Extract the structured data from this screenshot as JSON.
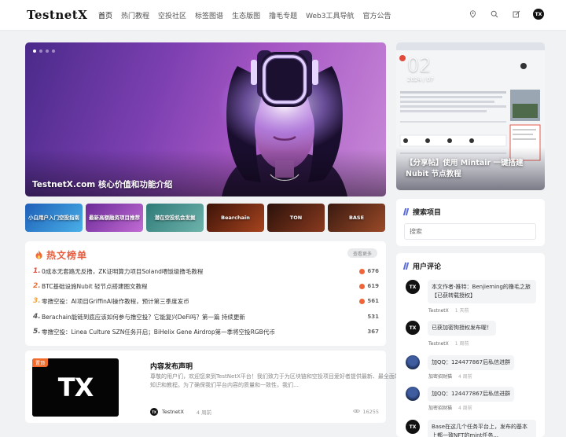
{
  "header": {
    "logo": "TestnetX",
    "nav": [
      "首页",
      "热门教程",
      "空投社区",
      "标签图谱",
      "生态版图",
      "撸毛专题",
      "Web3工具导航",
      "官方公告"
    ],
    "avatar_text": "TX"
  },
  "hero": {
    "caption": "TestnetX.com 核心价值和功能介绍"
  },
  "side_hero": {
    "day": "02",
    "month": "2024 / 07",
    "title": "【分享帖】使用 Mintair 一键搭建 Nubit 节点教程"
  },
  "thumbs": [
    {
      "label": "小白用户入门空投指南",
      "bg": "#2f7fd0"
    },
    {
      "label": "最新高额融资项目推荐",
      "bg": "#8a3aa8"
    },
    {
      "label": "潜在空投机会发掘",
      "bg": "#3d8b86"
    },
    {
      "label": "Bearchain",
      "bg": "#7b2a17"
    },
    {
      "label": "TON",
      "bg": "#3a1c12"
    },
    {
      "label": "BASE",
      "bg": "#4a2618"
    }
  ],
  "hot": {
    "title": "热文榜单",
    "more": "查看更多",
    "items": [
      {
        "rank": "1.",
        "title": "0成本无套路无反撸，ZK证明算力项目Soland喂饭级撸毛教程",
        "views": "676",
        "hot": true,
        "color": "#e74c3c"
      },
      {
        "rank": "2.",
        "title": "BTC基础设施Nubit 轻节点搭建图文教程",
        "views": "619",
        "hot": true,
        "color": "#e8743c"
      },
      {
        "rank": "3.",
        "title": "零撸空投：AI项目GriffinAI操作教程，预计第三季度发币",
        "views": "561",
        "hot": true,
        "color": "#f0a23c"
      },
      {
        "rank": "4.",
        "title": "Berachain能链到底应该如何参与撸空投？它能复兴DeFi吗？第一篇 持续更新",
        "views": "531",
        "hot": false,
        "color": "#555555"
      },
      {
        "rank": "5.",
        "title": "零撸空投：Linea Culture SZN任务开启；BiHelix Gene Airdrop第一季将空投RGB代币",
        "views": "367",
        "hot": false,
        "color": "#555555"
      }
    ]
  },
  "post": {
    "tag": "置顶",
    "thumb_text": "TX",
    "title": "内容发布声明",
    "excerpt": "尊敬的用户们，欢迎您来到TestNetX平台！我们致力于为区块链和空投项目爱好者提供最新、最全面的知识和教程。为了确保我们平台内容的质量和一致性，我们…",
    "author_avatar": "TX",
    "author": "TestnetX",
    "time": "4 周前",
    "views": "16255"
  },
  "search": {
    "title": "搜索项目",
    "placeholder": "搜索"
  },
  "comments": {
    "title": "用户评论",
    "items": [
      {
        "avatar": "TX",
        "pic": false,
        "text": "本文作者-推特：Benjieming的撸毛之旅【已获转载授权】",
        "author": "TestnetX",
        "time": "1 天前"
      },
      {
        "avatar": "TX",
        "pic": false,
        "text": "已获加密狗授权发布喔！",
        "author": "TestnetX",
        "time": "1 周前"
      },
      {
        "avatar": "",
        "pic": true,
        "text": "加QQ：124477867后私信进群",
        "author": "加密招财猫",
        "time": "4 周前"
      },
      {
        "avatar": "",
        "pic": true,
        "text": "加QQ：124477867后私信进群",
        "author": "加密招财猫",
        "time": "4 周前"
      },
      {
        "avatar": "TX",
        "pic": false,
        "text": "Base在这几个任务平台上，发布的基本上都一致NFT的mint任务...",
        "author": "",
        "time": ""
      }
    ]
  }
}
